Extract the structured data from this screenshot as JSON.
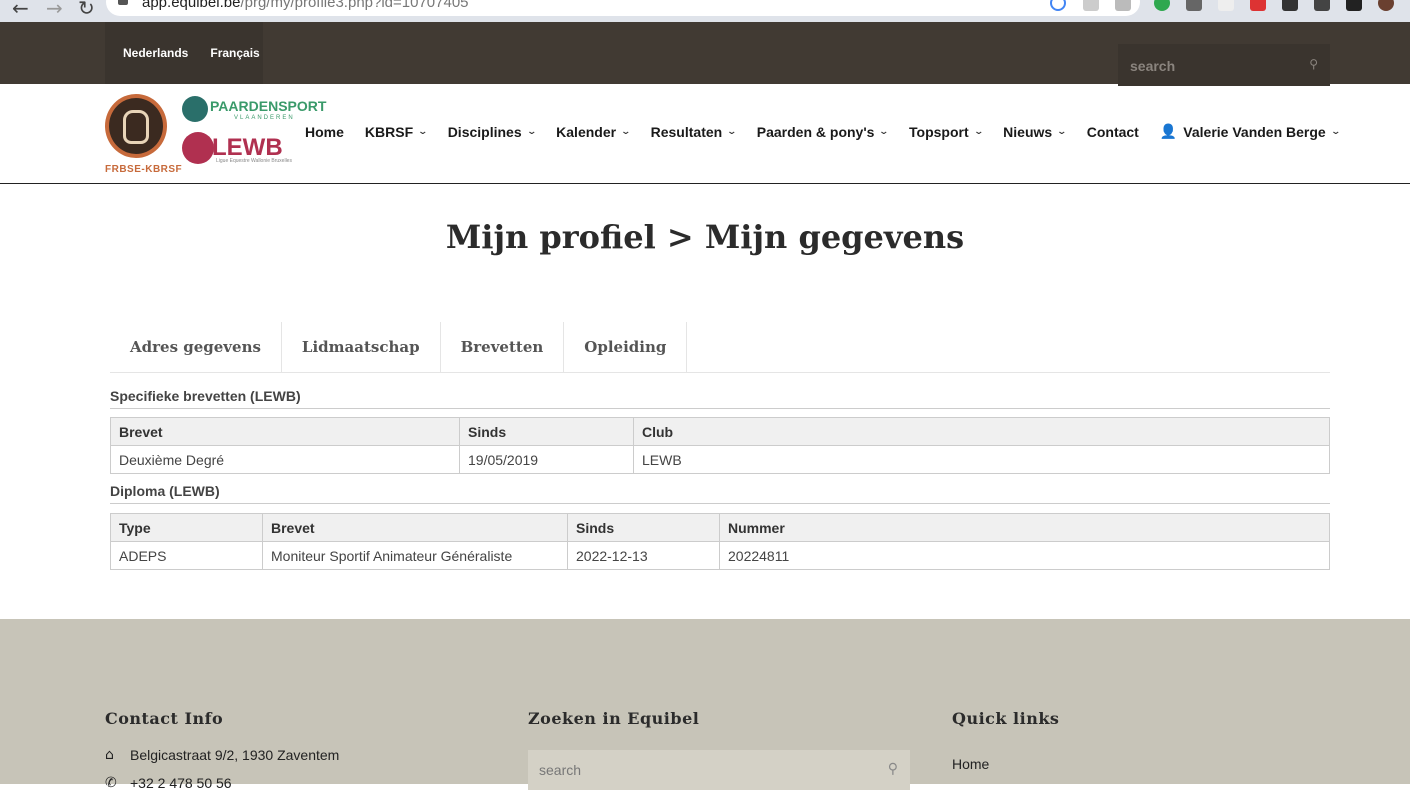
{
  "browser": {
    "url_host": "app.equibel.be",
    "url_path": "/prg/my/profile3.php?id=10707405"
  },
  "topbar": {
    "languages": [
      "Nederlands",
      "Français"
    ],
    "search_placeholder": "search"
  },
  "header": {
    "logo_caption": "FRBSE-KBRSF",
    "partner_logo_1_title": "PAARDENSPORT",
    "partner_logo_1_subtitle": "VLAANDEREN",
    "partner_logo_2_title": "LEWB",
    "partner_logo_2_subtitle": "Ligue Equestre Wallonie Bruxelles",
    "nav": [
      {
        "label": "Home",
        "dropdown": false
      },
      {
        "label": "KBRSF",
        "dropdown": true
      },
      {
        "label": "Disciplines",
        "dropdown": true
      },
      {
        "label": "Kalender",
        "dropdown": true
      },
      {
        "label": "Resultaten",
        "dropdown": true
      },
      {
        "label": "Paarden & pony's",
        "dropdown": true
      },
      {
        "label": "Topsport",
        "dropdown": true
      },
      {
        "label": "Nieuws",
        "dropdown": true
      },
      {
        "label": "Contact",
        "dropdown": false
      }
    ],
    "user_name": "Valerie Vanden Berge"
  },
  "page_title": "Mijn profiel > Mijn gegevens",
  "tabs": [
    "Adres gegevens",
    "Lidmaatschap",
    "Brevetten",
    "Opleiding"
  ],
  "brevetten": {
    "title": "Specifieke brevetten (LEWB)",
    "columns": [
      "Brevet",
      "Sinds",
      "Club"
    ],
    "rows": [
      [
        "Deuxième Degré",
        "19/05/2019",
        "LEWB"
      ]
    ]
  },
  "diploma": {
    "title": "Diploma (LEWB)",
    "columns": [
      "Type",
      "Brevet",
      "Sinds",
      "Nummer"
    ],
    "rows": [
      [
        "ADEPS",
        "Moniteur Sportif Animateur Généraliste",
        "2022-12-13",
        "20224811"
      ]
    ]
  },
  "footer": {
    "contact_title": "Contact Info",
    "address": "Belgicastraat 9/2, 1930 Zaventem",
    "phone": "+32 2 478 50 56",
    "search_title": "Zoeken in Equibel",
    "search_placeholder": "search",
    "quicklinks_title": "Quick links",
    "quicklinks": [
      "Home"
    ]
  }
}
